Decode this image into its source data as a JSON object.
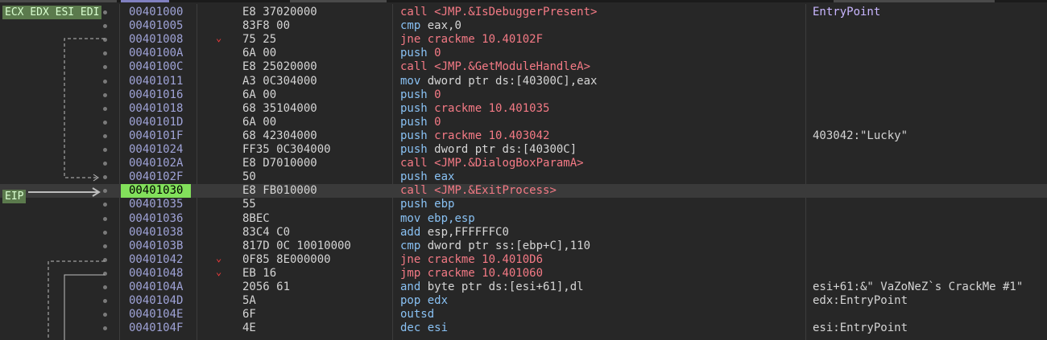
{
  "registers_label": "ECX EDX ESI EDI",
  "eip_label": "EIP",
  "rows": [
    {
      "addr": "00401000",
      "bytes": "E8 37020000",
      "mn": "call",
      "mncls": "mn-call",
      "ops": "<JMP.&IsDebuggerPresent>",
      "opscls": "op-lbl",
      "cmt": "EntryPoint",
      "cmtcls": "entry"
    },
    {
      "addr": "00401005",
      "bytes": "83F8 00",
      "mn": "cmp",
      "mncls": "mn-cmp",
      "ops": "eax,0",
      "opscls": "op"
    },
    {
      "addr": "00401008",
      "bytes": "75 25",
      "mn": "jne",
      "mncls": "mn-jcc",
      "ops": "crackme 10.40102F",
      "opscls": "op-lbl",
      "jump": true
    },
    {
      "addr": "0040100A",
      "bytes": "6A 00",
      "mn": "push",
      "mncls": "mn-push",
      "ops": "0",
      "opscls": "op-num"
    },
    {
      "addr": "0040100C",
      "bytes": "E8 25020000",
      "mn": "call",
      "mncls": "mn-call",
      "ops": "<JMP.&GetModuleHandleA>",
      "opscls": "op-lbl"
    },
    {
      "addr": "00401011",
      "bytes": "A3 0C304000",
      "mn": "mov",
      "mncls": "mn-mov",
      "ops": "dword ptr ds:[40300C],eax",
      "opscls": "op"
    },
    {
      "addr": "00401016",
      "bytes": "6A 00",
      "mn": "push",
      "mncls": "mn-push",
      "ops": "0",
      "opscls": "op-num"
    },
    {
      "addr": "00401018",
      "bytes": "68 35104000",
      "mn": "push",
      "mncls": "mn-push",
      "ops": "crackme 10.401035",
      "opscls": "op-lbl"
    },
    {
      "addr": "0040101D",
      "bytes": "6A 00",
      "mn": "push",
      "mncls": "mn-push",
      "ops": "0",
      "opscls": "op-num"
    },
    {
      "addr": "0040101F",
      "bytes": "68 42304000",
      "mn": "push",
      "mncls": "mn-push",
      "ops": "crackme 10.403042",
      "opscls": "op-lbl",
      "cmt": "403042:\"Lucky\""
    },
    {
      "addr": "00401024",
      "bytes": "FF35 0C304000",
      "mn": "push",
      "mncls": "mn-push",
      "ops": "dword ptr ds:[40300C]",
      "opscls": "op"
    },
    {
      "addr": "0040102A",
      "bytes": "E8 D7010000",
      "mn": "call",
      "mncls": "mn-call",
      "ops": "<JMP.&DialogBoxParamA>",
      "opscls": "op-lbl"
    },
    {
      "addr": "0040102F",
      "bytes": "50",
      "mn": "push",
      "mncls": "mn-push",
      "ops": "eax",
      "opscls": "op-reg"
    },
    {
      "addr": "00401030",
      "bytes": "E8 FB010000",
      "mn": "call",
      "mncls": "mn-call",
      "ops": "<JMP.&ExitProcess>",
      "opscls": "op-lbl",
      "current": true
    },
    {
      "addr": "00401035",
      "bytes": "55",
      "mn": "push",
      "mncls": "mn-push",
      "ops": "ebp",
      "opscls": "op-reg"
    },
    {
      "addr": "00401036",
      "bytes": "8BEC",
      "mn": "mov",
      "mncls": "mn-mov",
      "ops": "ebp,esp",
      "opscls": "op-reg"
    },
    {
      "addr": "00401038",
      "bytes": "83C4 C0",
      "mn": "add",
      "mncls": "mn-add",
      "ops": "esp,FFFFFFC0",
      "opscls": "op"
    },
    {
      "addr": "0040103B",
      "bytes": "817D 0C 10010000",
      "mn": "cmp",
      "mncls": "mn-cmp",
      "ops": "dword ptr ss:[ebp+C],110",
      "opscls": "op"
    },
    {
      "addr": "00401042",
      "bytes": "0F85 8E000000",
      "mn": "jne",
      "mncls": "mn-jcc",
      "ops": "crackme 10.4010D6",
      "opscls": "op-lbl",
      "jump": true
    },
    {
      "addr": "00401048",
      "bytes": "EB 16",
      "mn": "jmp",
      "mncls": "mn-jmp",
      "ops": "crackme 10.401060",
      "opscls": "op-lbl",
      "jump": true
    },
    {
      "addr": "0040104A",
      "bytes": "2056 61",
      "mn": "and",
      "mncls": "mn-and",
      "ops": "byte ptr ds:[esi+61],dl",
      "opscls": "op",
      "cmt": "esi+61:&\" VaZoNeZ`s CrackMe #1\""
    },
    {
      "addr": "0040104D",
      "bytes": "5A",
      "mn": "pop",
      "mncls": "mn-pop",
      "ops": "edx",
      "opscls": "op-reg",
      "cmt": "edx:EntryPoint"
    },
    {
      "addr": "0040104E",
      "bytes": "6F",
      "mn": "outsd",
      "mncls": "mn-outsd",
      "ops": "",
      "opscls": "op"
    },
    {
      "addr": "0040104F",
      "bytes": "4E",
      "mn": "dec",
      "mncls": "mn-dec",
      "ops": "esi",
      "opscls": "op-reg",
      "cmt": "esi:EntryPoint"
    }
  ]
}
